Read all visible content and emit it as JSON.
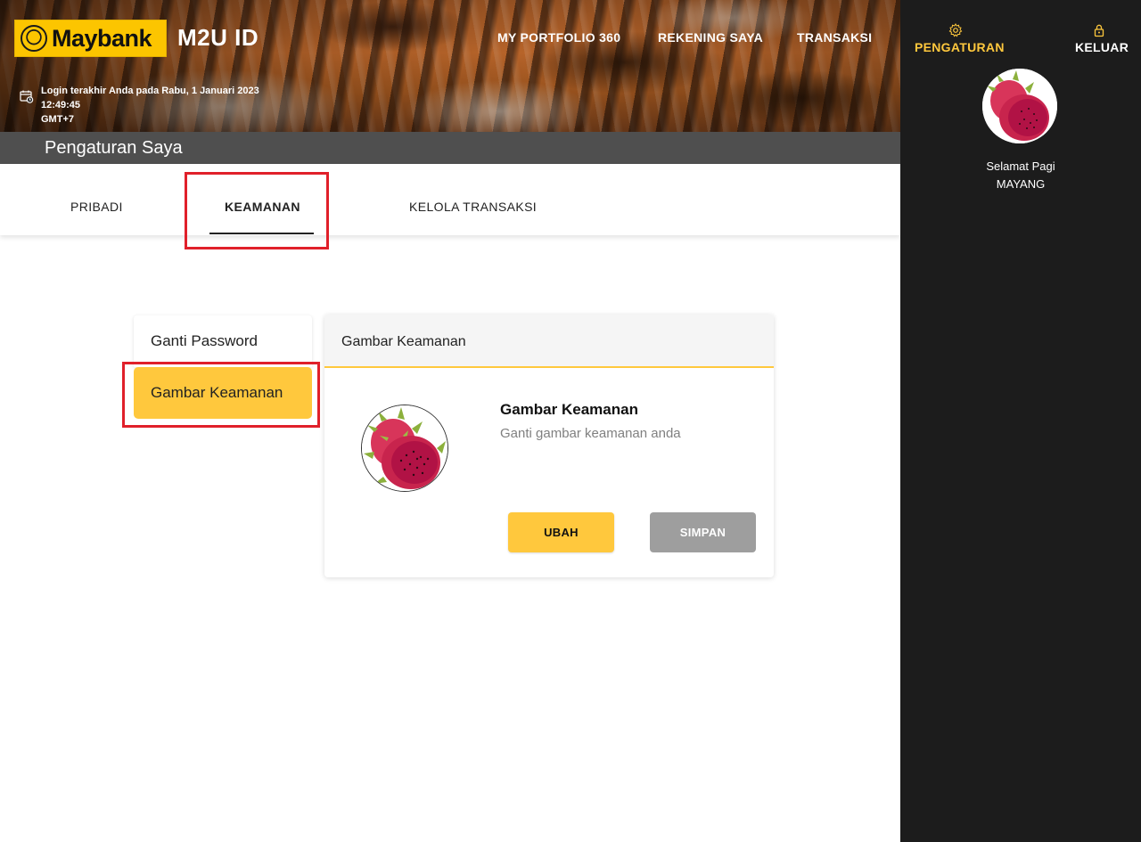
{
  "header": {
    "brand": "Maybank",
    "app_name": "M2U ID",
    "last_login_line1": "Login terakhir Anda pada Rabu, 1 Januari 2023 12:49:45",
    "last_login_line2": "GMT+7",
    "nav": {
      "portfolio": "MY PORTFOLIO 360",
      "accounts": "REKENING SAYA",
      "transactions": "TRANSAKSI"
    }
  },
  "page_title": "Pengaturan Saya",
  "tabs": {
    "personal": "PRIBADI",
    "security": "KEAMANAN",
    "manage_transactions": "KELOLA TRANSAKSI",
    "active": "KEAMANAN"
  },
  "side_menu": {
    "change_password": "Ganti Password",
    "security_image": "Gambar Keamanan",
    "selected": "Gambar Keamanan"
  },
  "card": {
    "header": "Gambar Keamanan",
    "title": "Gambar Keamanan",
    "description": "Ganti gambar keamanan anda",
    "image_icon": "dragon-fruit-image",
    "change_button": "UBAH",
    "save_button": "SIMPAN"
  },
  "right_panel": {
    "settings": "PENGATURAN",
    "settings_icon": "gear-icon",
    "logout": "KELUAR",
    "logout_icon": "lock-icon",
    "greeting": "Selamat Pagi",
    "user_name": "MAYANG"
  },
  "colors": {
    "brand_yellow": "#ffc83d",
    "highlight_red": "#e0202a",
    "panel_dark": "#1c1c1c",
    "title_bar": "#4f4f4f",
    "disabled_button": "#9e9e9e"
  }
}
